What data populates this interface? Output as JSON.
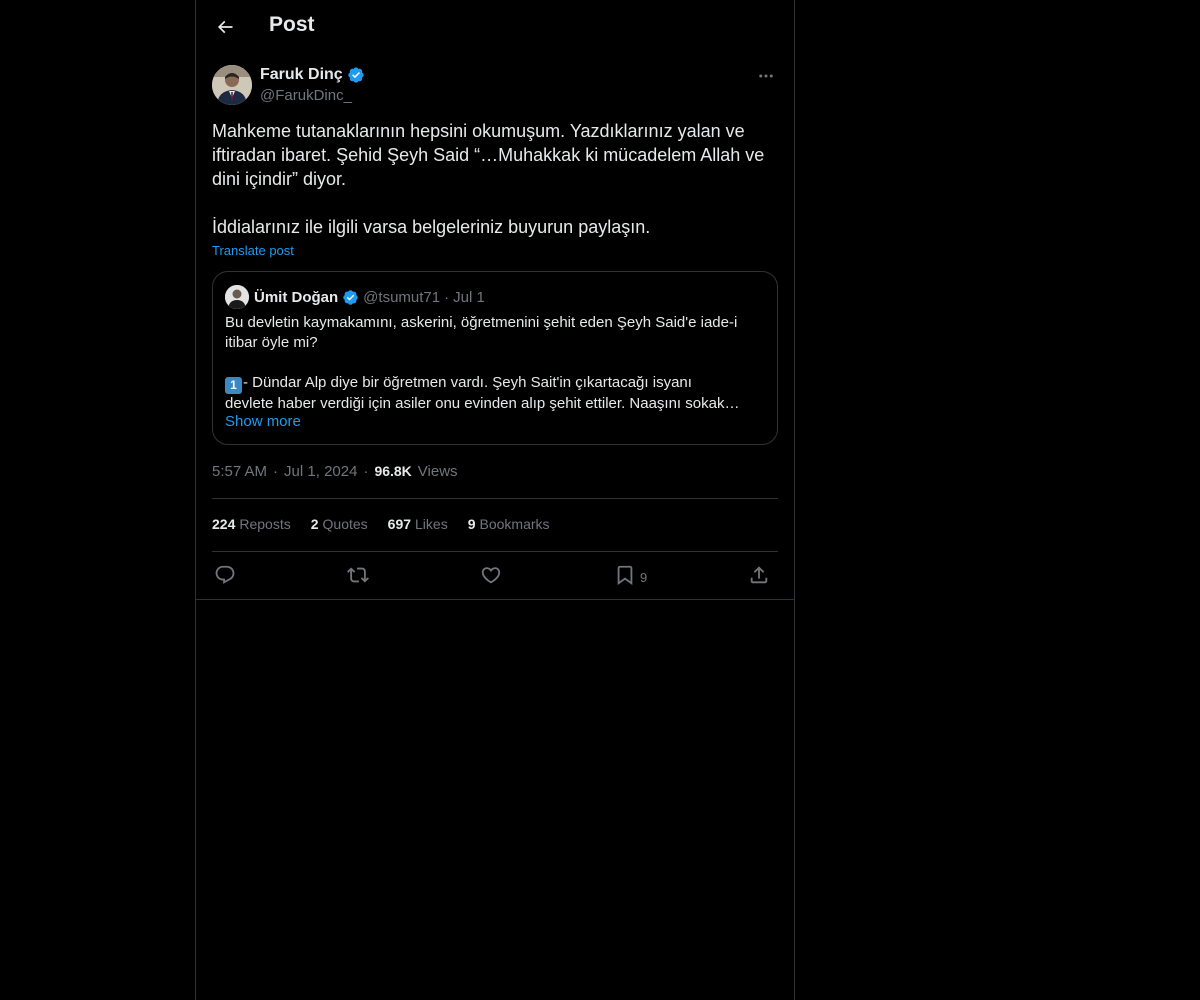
{
  "header": {
    "title": "Post"
  },
  "post": {
    "author": {
      "name": "Faruk Dinç",
      "handle": "@FarukDinc_",
      "verified": true
    },
    "text": "Mahkeme tutanaklarının hepsini okumuşum. Yazdıklarınız yalan ve iftiradan ibaret. Şehid Şeyh Said “…Muhakkak ki mücadelem Allah ve dini içindir” diyor.\n\nİddialarınız ile ilgili varsa belgeleriniz buyurun paylaşın.",
    "translate_label": "Translate post",
    "time": "5:57 AM",
    "date": "Jul 1, 2024",
    "views_count": "96.8K",
    "views_label": "Views"
  },
  "quote": {
    "name": "Ümit Doğan",
    "handle": "@tsumut71",
    "date": "Jul 1",
    "line1": "Bu devletin kaymakamını, askerini, öğretmenini şehit eden Şeyh Said'e iade-i",
    "line2": "itibar öyle mi?",
    "emoji": "1",
    "line3": "- Dündar Alp diye bir öğretmen vardı. Şeyh Sait'in çıkartacağı isyanı",
    "line4": "devlete haber verdiği için asiler onu evinden alıp şehit ettiler. Naaşını sokak…",
    "show_more": "Show more"
  },
  "stats": {
    "reposts_count": "224",
    "reposts_label": "Reposts",
    "quotes_count": "2",
    "quotes_label": "Quotes",
    "likes_count": "697",
    "likes_label": "Likes",
    "bookmarks_count": "9",
    "bookmarks_label": "Bookmarks"
  },
  "actions": {
    "bookmark_count": "9"
  },
  "colors": {
    "background": "#000000",
    "text": "#e7e9ea",
    "secondary": "#71767b",
    "accent": "#1d9bf0",
    "border": "#2f3336"
  }
}
